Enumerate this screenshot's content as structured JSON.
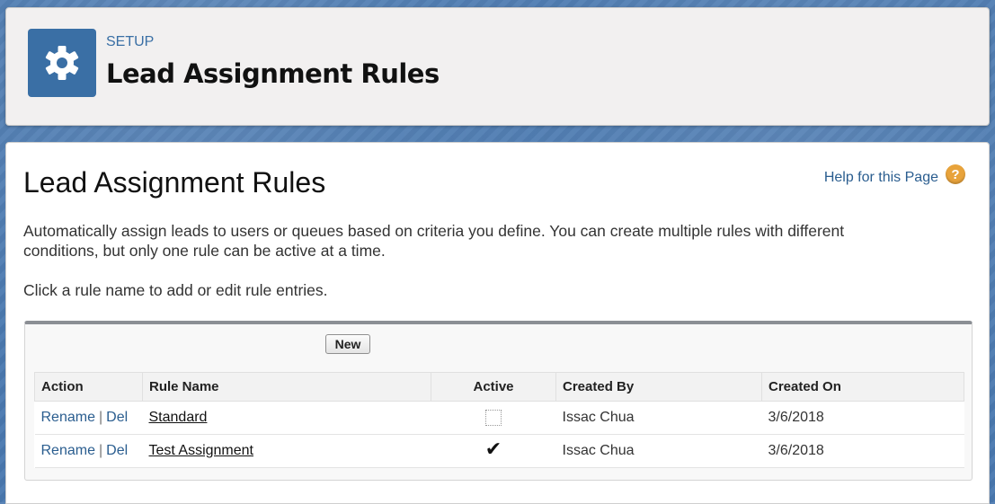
{
  "header": {
    "setup_label": "SETUP",
    "title": "Lead Assignment Rules",
    "icon": "gear-icon"
  },
  "page": {
    "title": "Lead Assignment Rules",
    "help_link": "Help for this Page",
    "help_icon": "?",
    "description": "Automatically assign leads to users or queues based on criteria you define. You can create multiple rules with different conditions, but only one rule can be active at a time.",
    "instructions": "Click a rule name to add or edit rule entries."
  },
  "toolbar": {
    "new_label": "New"
  },
  "table": {
    "columns": [
      "Action",
      "Rule Name",
      "Active",
      "Created By",
      "Created On"
    ],
    "rows": [
      {
        "rename": "Rename",
        "sep": "|",
        "del": "Del",
        "rule_name": "Standard",
        "active": false,
        "created_by": "Issac Chua",
        "created_on": "3/6/2018"
      },
      {
        "rename": "Rename",
        "sep": "|",
        "del": "Del",
        "rule_name": "Test Assignment",
        "active": true,
        "created_by": "Issac Chua",
        "created_on": "3/6/2018"
      }
    ]
  },
  "colors": {
    "brand_blue": "#3a6fa5",
    "link_blue": "#2a5d8f",
    "help_orange": "#e8a33b"
  }
}
